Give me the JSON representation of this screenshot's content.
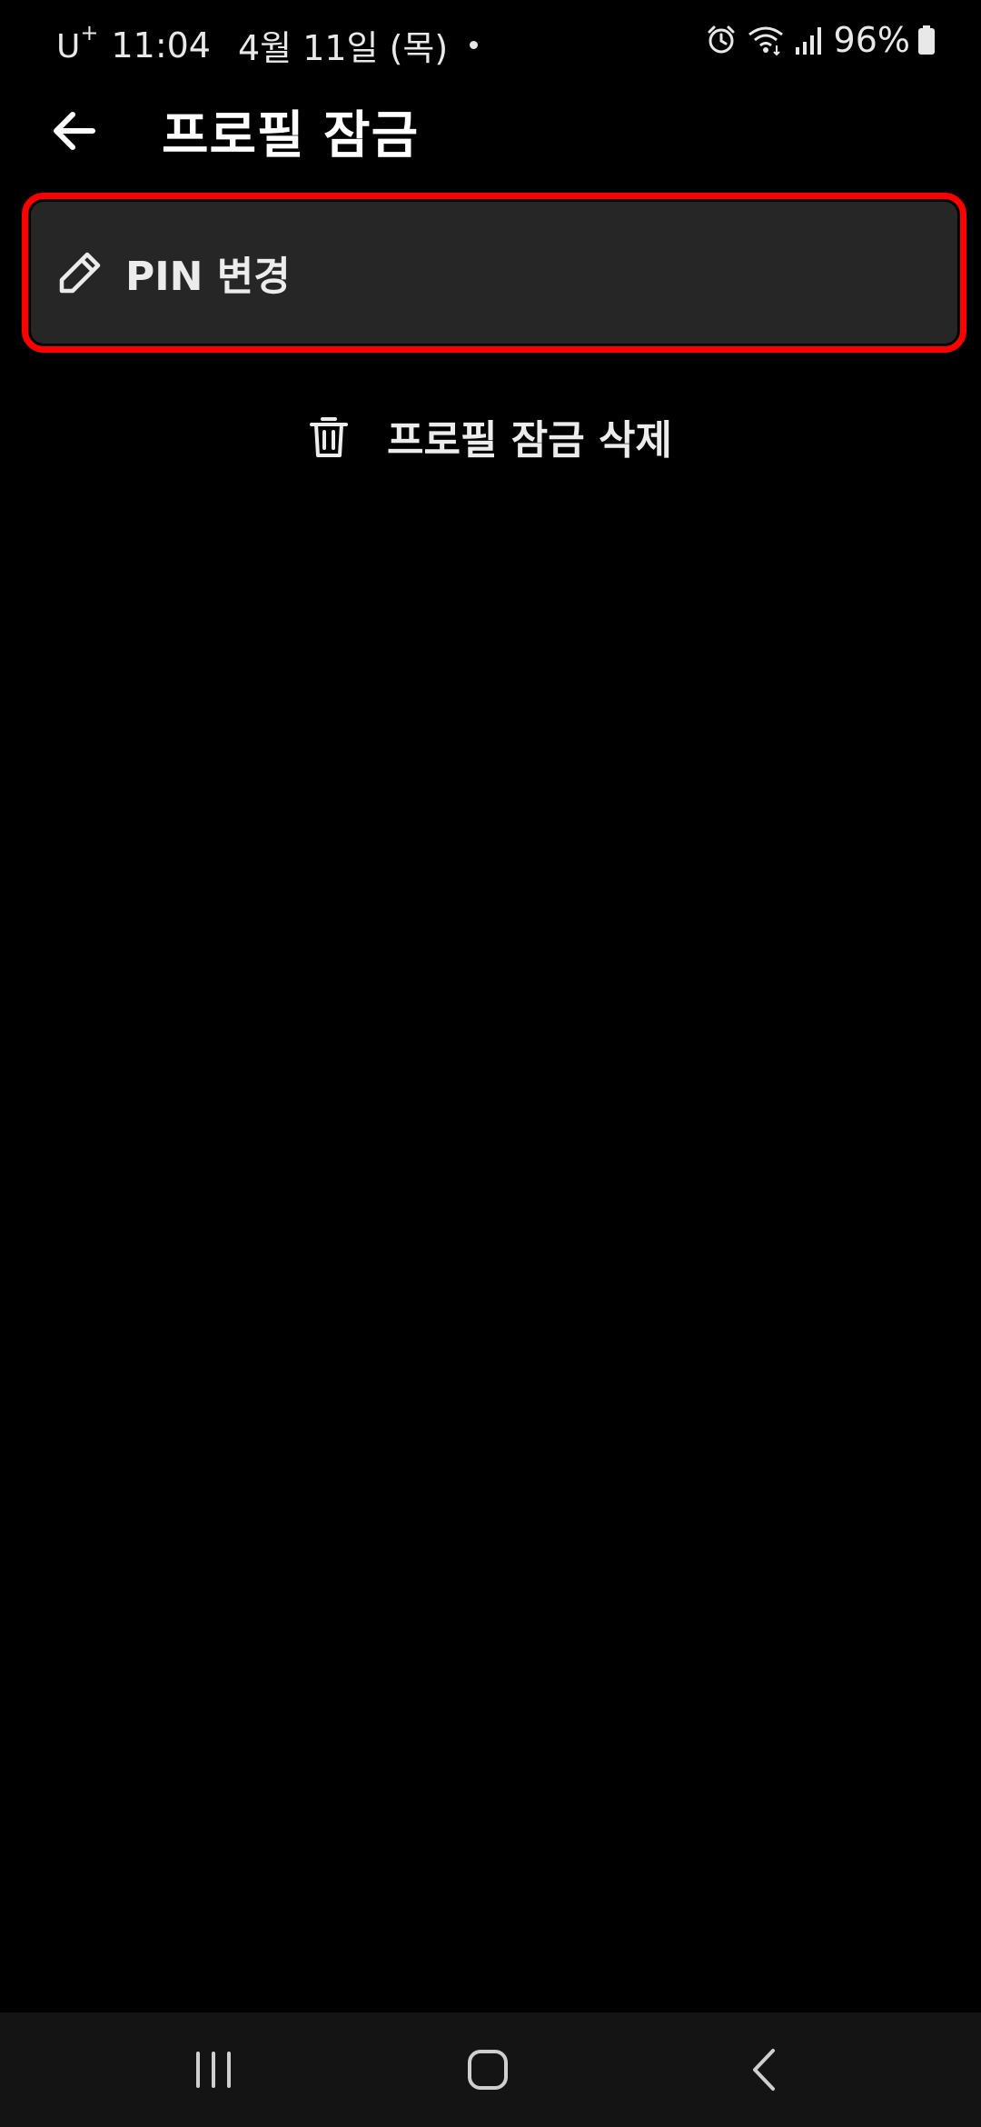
{
  "status_bar": {
    "carrier": "U",
    "carrier_sup": "+",
    "time": "11:04",
    "date": "4월 11일 (목)",
    "battery": "96%"
  },
  "app_bar": {
    "title": "프로필 잠금"
  },
  "menu": {
    "pin_change_label": "PIN 변경",
    "delete_lock_label": "프로필 잠금 삭제"
  },
  "colors": {
    "background": "#000000",
    "card": "#262626",
    "highlight": "#ff0000",
    "nav_bar": "#141414"
  },
  "icons": {
    "back": "arrow-left-icon",
    "pin_change": "pencil-icon",
    "delete_lock": "trash-icon"
  }
}
